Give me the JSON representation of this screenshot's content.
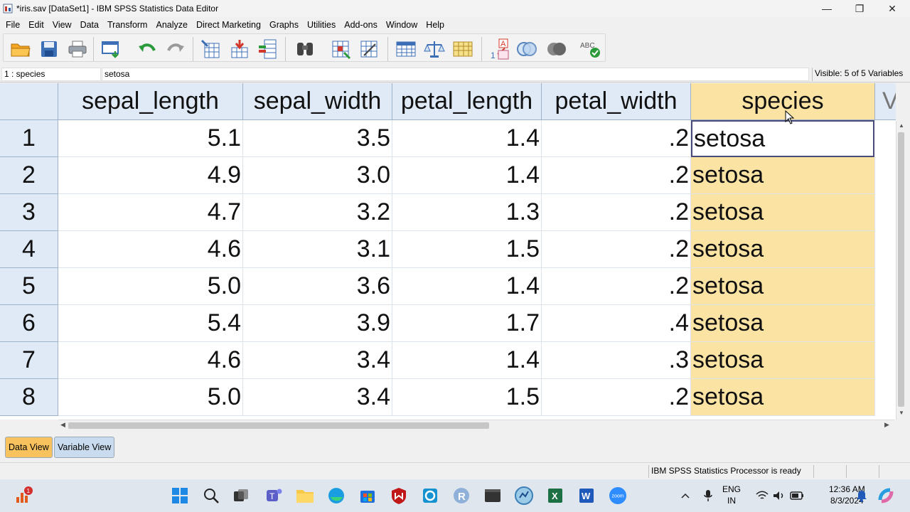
{
  "window": {
    "title": "*iris.sav [DataSet1] - IBM SPSS Statistics Data Editor",
    "minimize": "—",
    "maximize": "❐",
    "close": "✕"
  },
  "menu": [
    "File",
    "Edit",
    "View",
    "Data",
    "Transform",
    "Analyze",
    "Direct Marketing",
    "Graphs",
    "Utilities",
    "Add-ons",
    "Window",
    "Help"
  ],
  "toolbar": {
    "icons": [
      "open-folder-icon",
      "save-icon",
      "print-icon",
      "dialog-recall-icon",
      "undo-icon",
      "redo-icon",
      "goto-case-icon",
      "goto-variable-icon",
      "variables-icon",
      "find-icon",
      "insert-cases-icon",
      "insert-variable-icon",
      "split-file-icon",
      "weight-cases-icon",
      "select-cases-icon",
      "value-labels-icon",
      "use-sets-icon",
      "show-all-variables-icon",
      "spell-check-icon"
    ],
    "spell_label": "ABC"
  },
  "cellbar": {
    "cell_ref": "1 : species",
    "cell_value": "setosa",
    "visible": "Visible: 5 of 5 Variables"
  },
  "grid": {
    "columns": [
      "sepal_length",
      "sepal_width",
      "petal_length",
      "petal_width",
      "species"
    ],
    "next_column_partial": "V",
    "rows": [
      {
        "n": "1",
        "sepal_length": "5.1",
        "sepal_width": "3.5",
        "petal_length": "1.4",
        "petal_width": ".2",
        "species": "setosa"
      },
      {
        "n": "2",
        "sepal_length": "4.9",
        "sepal_width": "3.0",
        "petal_length": "1.4",
        "petal_width": ".2",
        "species": "setosa"
      },
      {
        "n": "3",
        "sepal_length": "4.7",
        "sepal_width": "3.2",
        "petal_length": "1.3",
        "petal_width": ".2",
        "species": "setosa"
      },
      {
        "n": "4",
        "sepal_length": "4.6",
        "sepal_width": "3.1",
        "petal_length": "1.5",
        "petal_width": ".2",
        "species": "setosa"
      },
      {
        "n": "5",
        "sepal_length": "5.0",
        "sepal_width": "3.6",
        "petal_length": "1.4",
        "petal_width": ".2",
        "species": "setosa"
      },
      {
        "n": "6",
        "sepal_length": "5.4",
        "sepal_width": "3.9",
        "petal_length": "1.7",
        "petal_width": ".4",
        "species": "setosa"
      },
      {
        "n": "7",
        "sepal_length": "4.6",
        "sepal_width": "3.4",
        "petal_length": "1.4",
        "petal_width": ".3",
        "species": "setosa"
      },
      {
        "n": "8",
        "sepal_length": "5.0",
        "sepal_width": "3.4",
        "petal_length": "1.5",
        "petal_width": ".2",
        "species": "setosa"
      }
    ],
    "selected_column": "species",
    "active_row": "1"
  },
  "tabs": {
    "data_view": "Data View",
    "variable_view": "Variable View"
  },
  "status": {
    "processor": "IBM SPSS Statistics Processor is ready"
  },
  "taskbar": {
    "notification_badge": "1",
    "lang_line1": "ENG",
    "lang_line2": "IN",
    "time": "12:36 AM",
    "date": "8/3/2024",
    "apps": [
      "start-icon",
      "search-icon",
      "task-view-icon",
      "teams-icon",
      "file-explorer-icon",
      "edge-icon",
      "store-icon",
      "mcafee-icon",
      "cortana-icon",
      "r-icon",
      "terminal-icon",
      "spss-icon",
      "excel-icon",
      "word-icon",
      "zoom-icon"
    ]
  },
  "colors": {
    "selected_column_bg": "#fae3a3",
    "header_bg": "#dfeaf6",
    "active_tab": "#f8c35e",
    "inactive_tab": "#c9dbee"
  }
}
